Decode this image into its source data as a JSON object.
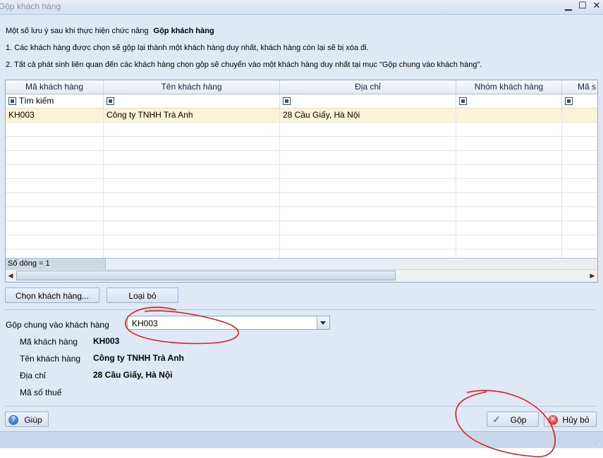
{
  "window": {
    "title": "Gộp khách hàng",
    "minimize_glyph": "▁",
    "maximize_glyph": "☐",
    "close_glyph": "✕"
  },
  "notes": {
    "line1_prefix": "Một số lưu ý sau khi thực hiện chức năng",
    "line1_bold": "Gộp khách hàng",
    "line2": "1. Các khách hàng được chọn sẽ gộp lại thành một khách hàng duy nhất, khách hàng còn lại sẽ bị xóa đi.",
    "line3": "2. Tất cả phát sinh liên quan đến các khách hàng chọn gộp sẽ chuyển vào một khách hàng duy nhất tại mục \"Gộp chung vào khách hàng\"."
  },
  "grid": {
    "columns": [
      "Mã khách hàng",
      "Tên khách hàng",
      "Địa chỉ",
      "Nhóm khách hàng",
      "Mã s"
    ],
    "search_label": "Tìm kiếm",
    "rows": [
      [
        "KH003",
        "Công ty TNHH Trà Anh",
        "28 Cầu Giấy, Hà Nội",
        "",
        ""
      ]
    ],
    "footer_count": "Số dòng = 1"
  },
  "buttons": {
    "choose_customer": "Chọn khách hàng...",
    "remove": "Loại bỏ",
    "help": "Giúp",
    "merge": "Gộp",
    "cancel": "Hủy bỏ"
  },
  "merge_target": {
    "label": "Gộp chung vào khách hàng",
    "selected": "KH003"
  },
  "details": {
    "code_label": "Mã khách hàng",
    "code_value": "KH003",
    "name_label": "Tên khách hàng",
    "name_value": "Công ty TNHH Trà Anh",
    "address_label": "Địa chỉ",
    "address_value": "28 Cầu Giấy, Hà Nội",
    "tax_label": "Mã số thuế",
    "tax_value": ""
  },
  "colors": {
    "annotation": "#e21b1b",
    "selected_row": "#fbf3d5",
    "window_bg": "#dfe9f5"
  }
}
